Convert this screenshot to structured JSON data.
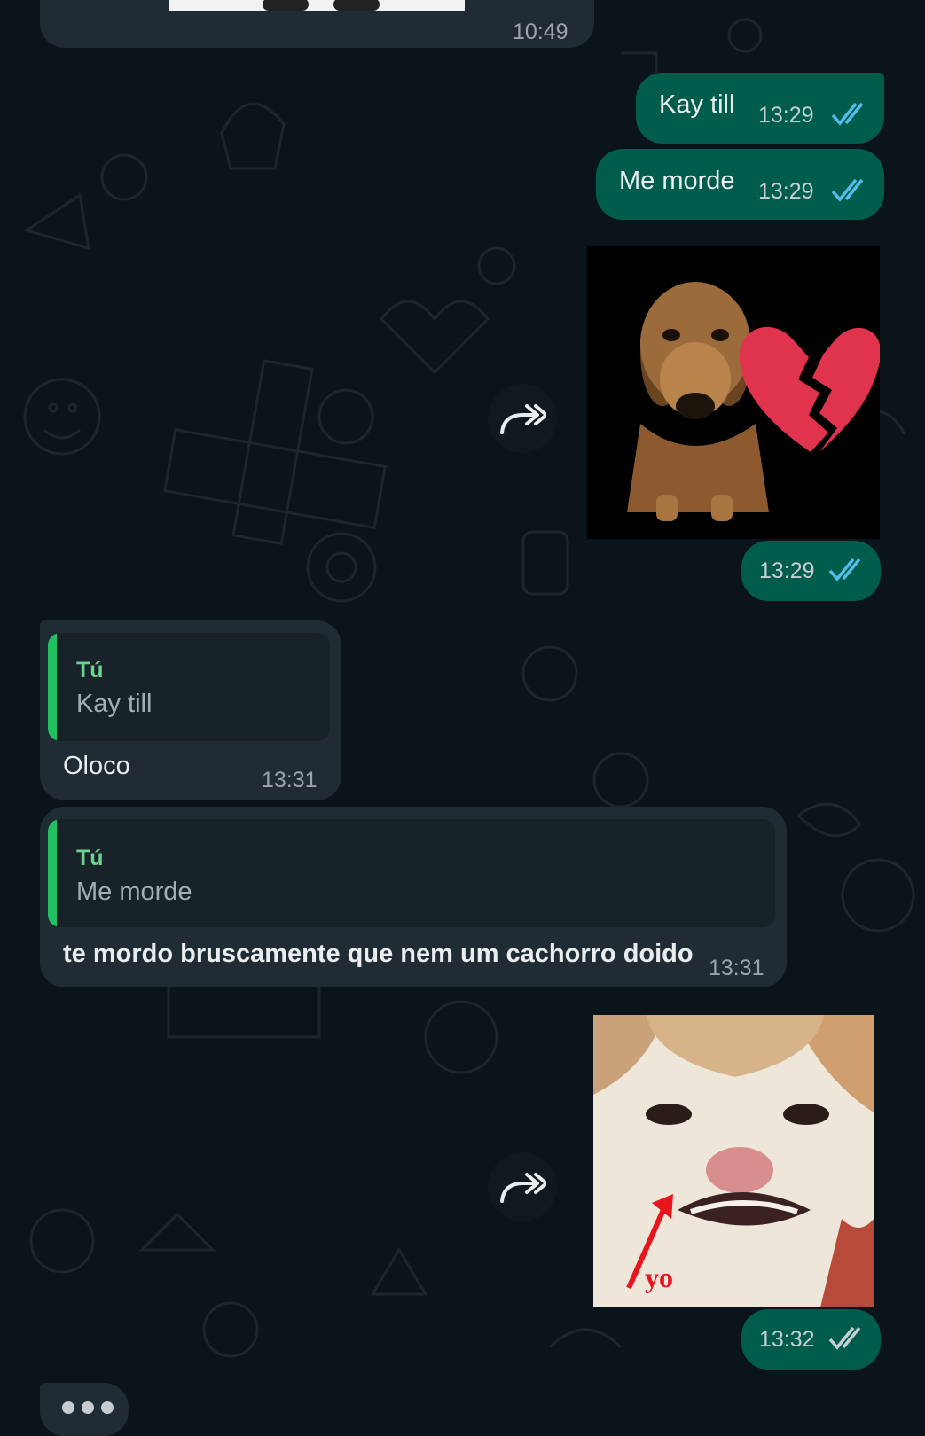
{
  "colors": {
    "background": "#0b141a",
    "incoming_bubble": "#1f2c34",
    "outgoing_bubble": "#005c4b",
    "read_ticks": "#53bdeb",
    "quote_bar": "#21c063"
  },
  "chat": {
    "top_partial": {
      "time": "10:49"
    },
    "messages": [
      {
        "id": "m1",
        "direction": "outgoing",
        "text": "Kay till",
        "time": "13:29",
        "status": "read"
      },
      {
        "id": "m2",
        "direction": "outgoing",
        "text": "Me morde",
        "time": "13:29",
        "status": "read"
      },
      {
        "id": "m3",
        "direction": "outgoing",
        "type": "sticker",
        "sticker": "dachshund-broken-heart",
        "time": "13:29",
        "status": "read"
      },
      {
        "id": "m4",
        "direction": "incoming",
        "quote_author": "Tú",
        "quote_text": "Kay till",
        "text": "Oloco",
        "time": "13:31"
      },
      {
        "id": "m5",
        "direction": "incoming",
        "quote_author": "Tú",
        "quote_text": "Me morde",
        "text": "te mordo bruscamente que nem um cachorro doido",
        "time": "13:31"
      },
      {
        "id": "m6",
        "direction": "outgoing",
        "type": "sticker",
        "sticker": "crying-cat-yo",
        "sticker_caption": "yo",
        "time": "13:32",
        "status": "delivered"
      }
    ],
    "typing_indicator": "typing-dots"
  }
}
